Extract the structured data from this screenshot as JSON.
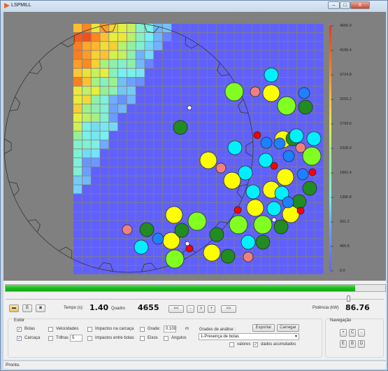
{
  "window": {
    "title": "LSPMILL",
    "minimize": "–",
    "maximize": "□",
    "close": "X"
  },
  "colorbar": {
    "ticks": [
      "4656.0",
      "4190.4",
      "3724.8",
      "3259.2",
      "2793.6",
      "2328.0",
      "1862.4",
      "1396.8",
      "931.2",
      "465.6",
      "0.0"
    ],
    "min": 0,
    "max": 4656
  },
  "progress": {
    "percent": 92
  },
  "slider": {
    "position_percent": 91
  },
  "toolbar": {
    "open_icon": "folder-icon",
    "b_label": "B",
    "camera_icon": "camera-icon",
    "tempo_label": "Tempo (s):",
    "tempo_value": "1.40",
    "quadro_label": "Quadro",
    "quadro_value": "4655",
    "nav": [
      "<<",
      "-",
      ">",
      "+",
      ">>"
    ],
    "potencia_label": "Potência (kW)",
    "potencia_value": "86.76"
  },
  "exibir": {
    "title": "Exibir",
    "bolas": {
      "label": "Bolas",
      "checked": true
    },
    "carcaca": {
      "label": "Carcaça",
      "checked": true
    },
    "velocidades": {
      "label": "Velocidades",
      "checked": false
    },
    "trilhas": {
      "label": "Trilhas",
      "checked": false,
      "value": "5"
    },
    "impactos_carcaca": {
      "label": "Impactos na carcaça",
      "checked": false
    },
    "impactos_bolas": {
      "label": "Impactos entre bolas",
      "checked": false
    },
    "grade": {
      "label": "Grade:",
      "checked": false,
      "value": "0.100",
      "unit": "m"
    },
    "eixos": {
      "label": "Eixos",
      "checked": false
    },
    "angulos": {
      "label": "Angulos",
      "checked": false
    }
  },
  "analise": {
    "label": "Grades de análise :",
    "selected": "1-Presença de bolas",
    "exportar": "Exportar",
    "carregar": "Carregar",
    "valores": {
      "label": "valores",
      "checked": false
    },
    "acumulados": {
      "label": "dados acumulados",
      "checked": true
    }
  },
  "navegacao": {
    "title": "Navegação",
    "buttons": [
      "+",
      "C",
      "-",
      "E",
      "B",
      "D"
    ]
  },
  "status": {
    "text": "Pronto."
  },
  "colors": {
    "background": "#808080",
    "progress": "#1dbb1d"
  }
}
